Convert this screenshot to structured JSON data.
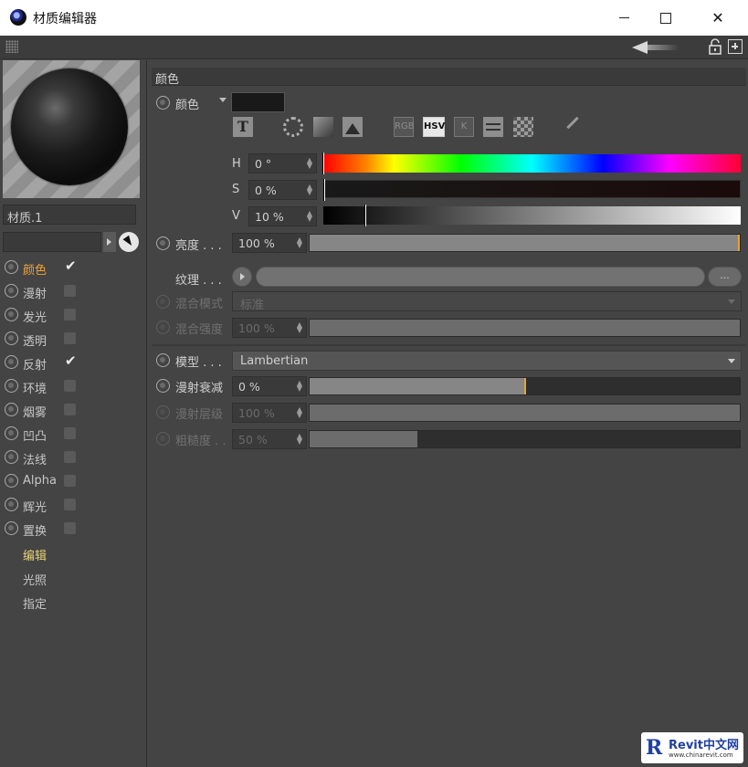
{
  "window": {
    "title": "材质编辑器",
    "minimize_glyph": "",
    "close_glyph": "✕"
  },
  "toolbar": {
    "icons": [
      "grip-icon",
      "back-arrow-icon",
      "lock-icon",
      "new-window-icon"
    ]
  },
  "material": {
    "name": "材质.1",
    "search_value": ""
  },
  "channels": [
    {
      "label": "颜色",
      "checked": true,
      "active": true
    },
    {
      "label": "漫射",
      "checked": false,
      "active": false
    },
    {
      "label": "发光",
      "checked": false,
      "active": false
    },
    {
      "label": "透明",
      "checked": false,
      "active": false
    },
    {
      "label": "反射",
      "checked": true,
      "active": false
    },
    {
      "label": "环境",
      "checked": false,
      "active": false
    },
    {
      "label": "烟雾",
      "checked": false,
      "active": false
    },
    {
      "label": "凹凸",
      "checked": false,
      "active": false
    },
    {
      "label": "法线",
      "checked": false,
      "active": false
    },
    {
      "label": "Alpha",
      "checked": false,
      "active": false
    },
    {
      "label": "辉光",
      "checked": false,
      "active": false
    },
    {
      "label": "置换",
      "checked": false,
      "active": false
    }
  ],
  "sub_pages": [
    {
      "label": "编辑",
      "active": true
    },
    {
      "label": "光照",
      "active": false
    },
    {
      "label": "指定",
      "active": false
    }
  ],
  "section": {
    "title": "颜色"
  },
  "color": {
    "label": "颜色",
    "swatch_hex": "#191919",
    "mode_buttons": {
      "rgb": "RGB",
      "hsv": "HSV",
      "k": "K"
    },
    "active_mode": "HSV",
    "h": {
      "label": "H",
      "value": "0 °",
      "level": 0.0
    },
    "s": {
      "label": "S",
      "value": "0 %",
      "level": 0.0
    },
    "v": {
      "label": "V",
      "value": "10 %",
      "level": 0.1
    }
  },
  "params": {
    "brightness": {
      "label": "亮度 . . .",
      "value": "100 %",
      "level": 1.0
    },
    "texture": {
      "label": "纹理 . . .",
      "more": "..."
    },
    "mix_mode": {
      "label": "混合模式",
      "value": "标准"
    },
    "mix_strength": {
      "label": "混合强度",
      "value": "100 %",
      "level": 1.0
    },
    "model": {
      "label": "模型 . . .",
      "value": "Lambertian"
    },
    "diffuse_falloff": {
      "label": "漫射衰减",
      "value": "0 %",
      "level": 0.5
    },
    "diffuse_level": {
      "label": "漫射层级",
      "value": "100 %",
      "level": 1.0
    },
    "roughness": {
      "label": "粗糙度 . .",
      "value": "50 %",
      "level": 0.5
    }
  },
  "watermark": {
    "logo": "R",
    "title": "Revit中文网",
    "url": "www.chinarevit.com"
  },
  "colors": {
    "accent_orange": "#f0a33a",
    "active_subpage": "#e6d17a",
    "panel_bg": "#444444"
  }
}
